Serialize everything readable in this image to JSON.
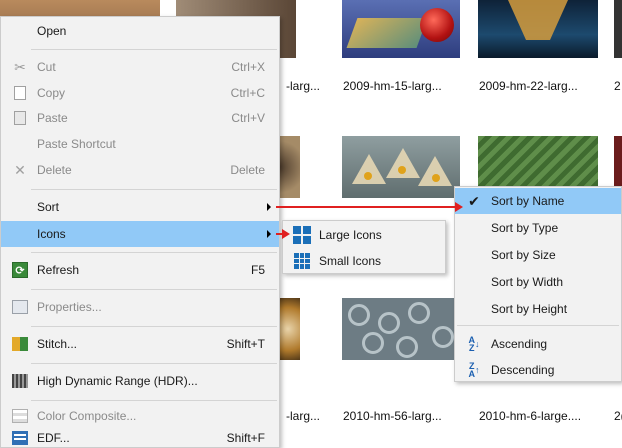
{
  "thumbnails": {
    "row1_captions": [
      "-larg...",
      "2009-hm-15-larg...",
      "2009-hm-22-larg...",
      "2"
    ],
    "row3_captions": [
      "-larg...",
      "2010-hm-56-larg...",
      "2010-hm-6-large....",
      "2("
    ]
  },
  "main_menu": {
    "items": [
      {
        "label": "Open",
        "shortcut": "",
        "icon": "none",
        "disabled": false
      },
      {
        "label": "Cut",
        "shortcut": "Ctrl+X",
        "icon": "scissors-icon",
        "disabled": true
      },
      {
        "label": "Copy",
        "shortcut": "Ctrl+C",
        "icon": "copy-icon",
        "disabled": true
      },
      {
        "label": "Paste",
        "shortcut": "Ctrl+V",
        "icon": "paste-icon",
        "disabled": true
      },
      {
        "label": "Paste Shortcut",
        "shortcut": "",
        "icon": "none",
        "disabled": true
      },
      {
        "label": "Delete",
        "shortcut": "Delete",
        "icon": "delete-icon",
        "disabled": true
      },
      {
        "label": "Sort",
        "shortcut": "",
        "icon": "none",
        "disabled": false,
        "submenu": true
      },
      {
        "label": "Icons",
        "shortcut": "",
        "icon": "none",
        "disabled": false,
        "submenu": true,
        "highlighted": true
      },
      {
        "label": "Refresh",
        "shortcut": "F5",
        "icon": "refresh-icon",
        "disabled": false
      },
      {
        "label": "Properties...",
        "shortcut": "",
        "icon": "properties-icon",
        "disabled": true
      },
      {
        "label": "Stitch...",
        "shortcut": "Shift+T",
        "icon": "stitch-icon",
        "disabled": false
      },
      {
        "label": "High Dynamic Range (HDR)...",
        "shortcut": "",
        "icon": "hdr-icon",
        "disabled": false
      },
      {
        "label": "Color Composite...",
        "shortcut": "",
        "icon": "composite-icon",
        "disabled": true
      },
      {
        "label": "EDF...",
        "shortcut": "Shift+F",
        "icon": "edf-icon",
        "disabled": false
      }
    ]
  },
  "icons_menu": {
    "items": [
      {
        "label": "Large Icons",
        "icon": "large-icons-icon"
      },
      {
        "label": "Small Icons",
        "icon": "small-icons-icon"
      }
    ]
  },
  "sort_menu": {
    "items": [
      {
        "label": "Sort by Name",
        "checked": true,
        "highlighted": true
      },
      {
        "label": "Sort by Type",
        "checked": false
      },
      {
        "label": "Sort by Size",
        "checked": false
      },
      {
        "label": "Sort by Width",
        "checked": false
      },
      {
        "label": "Sort by Height",
        "checked": false
      },
      {
        "label": "Ascending",
        "icon": "sort-ascending-icon"
      },
      {
        "label": "Descending",
        "icon": "sort-descending-icon"
      }
    ],
    "check_glyph": "✔"
  },
  "colors": {
    "highlight": "#91c9f7",
    "annotation_arrow": "#e02020",
    "menu_background": "#f2f2f2"
  }
}
